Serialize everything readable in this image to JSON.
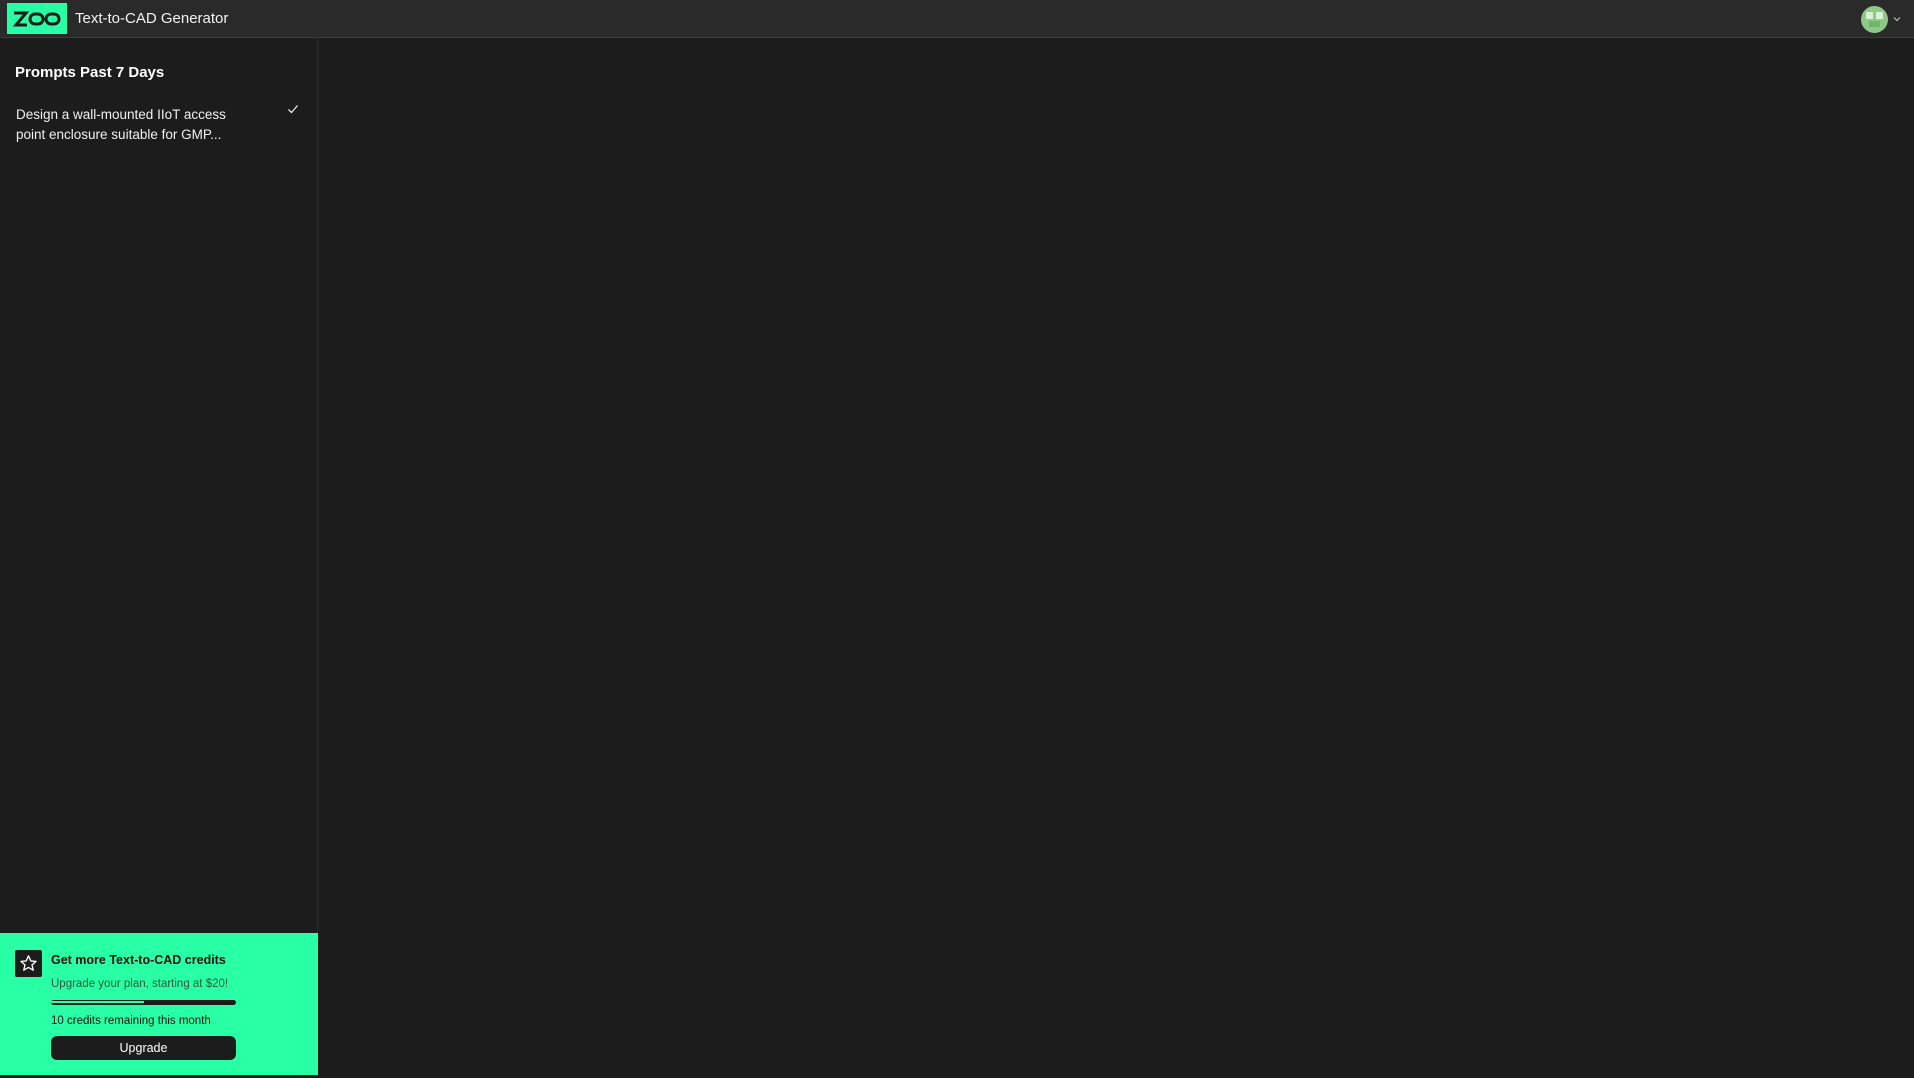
{
  "header": {
    "logo_text": "ZOO",
    "title": "Text-to-CAD Generator",
    "user_menu_icon": "chevron-down-icon",
    "brand_color": "#29ffa4"
  },
  "sidebar": {
    "heading": "Prompts Past 7 Days",
    "prompts": [
      {
        "text": "Design a wall-mounted IIoT access point enclosure suitable for GMP...",
        "status_icon": "checkmark-icon"
      }
    ]
  },
  "promo": {
    "icon": "star-icon",
    "title": "Get more Text-to-CAD credits",
    "subtitle": "Upgrade your plan, starting at $20!",
    "credits_text": "10 credits remaining this month",
    "progress_fraction": 0.5,
    "button_label": "Upgrade"
  }
}
